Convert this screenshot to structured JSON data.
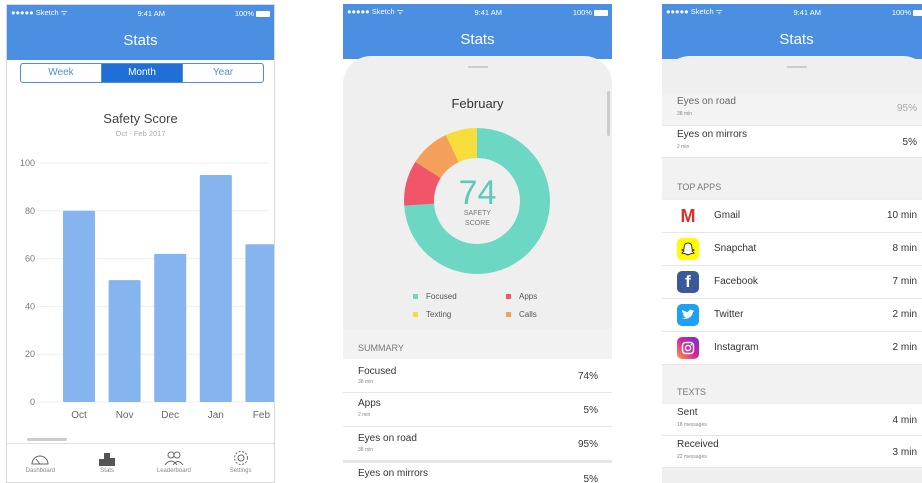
{
  "status_bar": {
    "carrier": "●●●●● Sketch ᯤ",
    "time": "9:41 AM",
    "battery": "100%"
  },
  "header": {
    "title": "Stats"
  },
  "screen1": {
    "segments": [
      {
        "label": "Week"
      },
      {
        "label": "Month",
        "active": true
      },
      {
        "label": "Year"
      }
    ],
    "chart_data": {
      "type": "bar",
      "title": "Safety Score",
      "subtitle": "Oct - Feb 2017",
      "categories": [
        "Oct",
        "Nov",
        "Dec",
        "Jan",
        "Feb"
      ],
      "values": [
        80,
        51,
        62,
        95,
        66
      ],
      "ylim": [
        0,
        100
      ],
      "yticks": [
        "100",
        "80",
        "60",
        "40",
        "20",
        "0"
      ],
      "grid": true,
      "bar_color": "#86b4ef"
    },
    "tabs": [
      {
        "label": "Dashboard",
        "icon": "gauge-icon"
      },
      {
        "label": "Stats",
        "icon": "stats-icon"
      },
      {
        "label": "Leaderboard",
        "icon": "people-icon"
      },
      {
        "label": "Settings",
        "icon": "gear-icon"
      }
    ]
  },
  "screen2": {
    "month": "February",
    "score": "74",
    "score_label_1": "SAFETY",
    "score_label_2": "SCORE",
    "donut": {
      "type": "pie",
      "segments": [
        {
          "name": "Focused",
          "value": 74,
          "color": "#6cd8c3"
        },
        {
          "name": "Apps",
          "value": 10,
          "color": "#f0556a"
        },
        {
          "name": "Calls",
          "value": 9,
          "color": "#f5a05a"
        },
        {
          "name": "Texting",
          "value": 7,
          "color": "#f6dd3c"
        }
      ]
    },
    "legend": [
      {
        "name": "Focused",
        "color": "#6cd8c3"
      },
      {
        "name": "Apps",
        "color": "#f0556a"
      },
      {
        "name": "Texting",
        "color": "#f6dd3c"
      },
      {
        "name": "Calls",
        "color": "#f5a05a"
      }
    ],
    "summary_title": "SUMMARY",
    "summary": [
      {
        "label": "Focused",
        "sub": "38 min",
        "value": "74%"
      },
      {
        "label": "Apps",
        "sub": "2 min",
        "value": "5%"
      },
      {
        "label": "Eyes on road",
        "sub": "38 min",
        "value": "95%"
      },
      {
        "label": "Eyes on mirrors",
        "sub": "",
        "value": "5%"
      }
    ]
  },
  "screen3": {
    "rows": [
      {
        "label": "Eyes on road",
        "sub": "38 min",
        "value": "95%"
      },
      {
        "label": "Eyes on mirrors",
        "sub": "2 min",
        "value": "5%"
      }
    ],
    "top_apps_title": "TOP APPS",
    "top_apps": [
      {
        "name": "Gmail",
        "value": "10 min",
        "icon": "gmail-icon",
        "color": "#ffffff",
        "glyph": "M"
      },
      {
        "name": "Snapchat",
        "value": "8 min",
        "icon": "snapchat-icon",
        "color": "#fffc00",
        "glyph": "👻"
      },
      {
        "name": "Facebook",
        "value": "7 min",
        "icon": "facebook-icon",
        "color": "#3b5998",
        "glyph": "f"
      },
      {
        "name": "Twitter",
        "value": "2 min",
        "icon": "twitter-icon",
        "color": "#1da1f2",
        "glyph": "🐦"
      },
      {
        "name": "Instagram",
        "value": "2 min",
        "icon": "instagram-icon",
        "color": "#c13584",
        "glyph": "◎"
      }
    ],
    "texts_title": "TEXTS",
    "texts": [
      {
        "label": "Sent",
        "sub": "18 messages",
        "value": "4 min"
      },
      {
        "label": "Received",
        "sub": "22 messages",
        "value": "3 min"
      }
    ]
  }
}
